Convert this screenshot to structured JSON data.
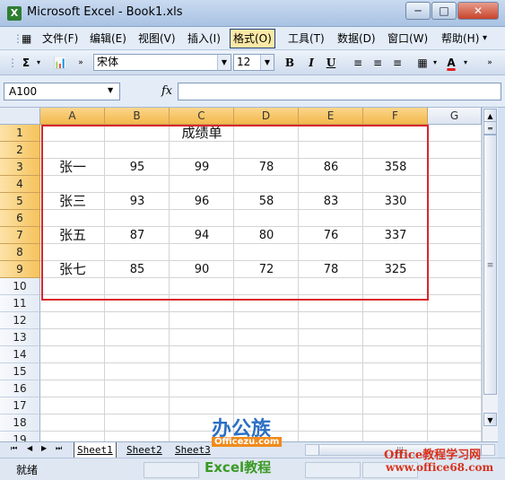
{
  "window": {
    "app_icon": "excel-icon",
    "title": "Microsoft Excel - Book1.xls",
    "controls": {
      "minimize": "─",
      "maximize": "□",
      "close": "✕"
    }
  },
  "menu": {
    "items": [
      {
        "name": "menu-file",
        "label": "文件(F)"
      },
      {
        "name": "menu-edit",
        "label": "编辑(E)"
      },
      {
        "name": "menu-view",
        "label": "视图(V)"
      },
      {
        "name": "menu-insert",
        "label": "插入(I)"
      },
      {
        "name": "menu-format",
        "label": "格式(O)"
      },
      {
        "name": "menu-tools",
        "label": "工具(T)"
      },
      {
        "name": "menu-data",
        "label": "数据(D)"
      },
      {
        "name": "menu-window",
        "label": "窗口(W)"
      },
      {
        "name": "menu-help",
        "label": "帮助(H)"
      }
    ],
    "doc_controls": "_ ▫ ✕"
  },
  "toolbar": {
    "autosum": "Σ",
    "font_name": "宋体",
    "font_size": "12",
    "bold": "B",
    "italic": "I",
    "underline": "U",
    "font_color_glyph": "A",
    "font_color": "#e02020"
  },
  "formula_bar": {
    "name_box": "A100",
    "fx": "fx",
    "formula": ""
  },
  "sheet": {
    "columns": [
      "A",
      "B",
      "C",
      "D",
      "E",
      "F",
      "G"
    ],
    "rows": [
      "1",
      "2",
      "3",
      "4",
      "5",
      "6",
      "7",
      "8",
      "9",
      "10",
      "11",
      "12",
      "13",
      "14",
      "15",
      "16",
      "17",
      "18",
      "19"
    ],
    "title": "成绩单",
    "records": [
      {
        "row": "3",
        "name": "张一",
        "b": "95",
        "c": "99",
        "d": "78",
        "e": "86",
        "f": "358"
      },
      {
        "row": "5",
        "name": "张三",
        "b": "93",
        "c": "96",
        "d": "58",
        "e": "83",
        "f": "330"
      },
      {
        "row": "7",
        "name": "张五",
        "b": "87",
        "c": "94",
        "d": "80",
        "e": "76",
        "f": "337"
      },
      {
        "row": "9",
        "name": "张七",
        "b": "85",
        "c": "90",
        "d": "72",
        "e": "78",
        "f": "325"
      }
    ]
  },
  "tabs": {
    "nav": [
      "⏮",
      "◀",
      "▶",
      "⏭"
    ],
    "sheets": [
      "Sheet1",
      "Sheet2",
      "Sheet3"
    ]
  },
  "status": {
    "text": "就绪"
  },
  "watermarks": {
    "logo": "办公族",
    "logo_url": "Officezu.com",
    "tutorial": "Excel教程",
    "site_cn": "Office教程学习网",
    "site_url": "www.office68.com"
  }
}
